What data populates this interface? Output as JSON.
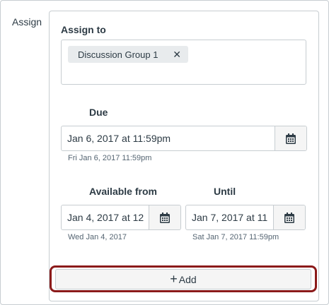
{
  "assign_label": "Assign",
  "assign_to": {
    "heading": "Assign to",
    "tags": [
      {
        "label": "Discussion Group 1",
        "remove_icon": "close-icon"
      }
    ]
  },
  "due": {
    "label": "Due",
    "value": "Jan 6, 2017 at 11:59pm",
    "helper": "Fri Jan 6, 2017 11:59pm",
    "icon": "calendar-icon"
  },
  "available_from": {
    "label": "Available from",
    "value": "Jan 4, 2017 at 12",
    "helper": "Wed Jan 4, 2017",
    "icon": "calendar-icon"
  },
  "until": {
    "label": "Until",
    "value": "Jan 7, 2017 at 11",
    "helper": "Sat Jan 7, 2017 11:59pm",
    "icon": "calendar-icon"
  },
  "add_button": {
    "icon": "plus-icon",
    "label": "Add"
  },
  "colors": {
    "highlight": "#8b1a1a",
    "text": "#2d3b45",
    "border": "#c7cdd1"
  }
}
